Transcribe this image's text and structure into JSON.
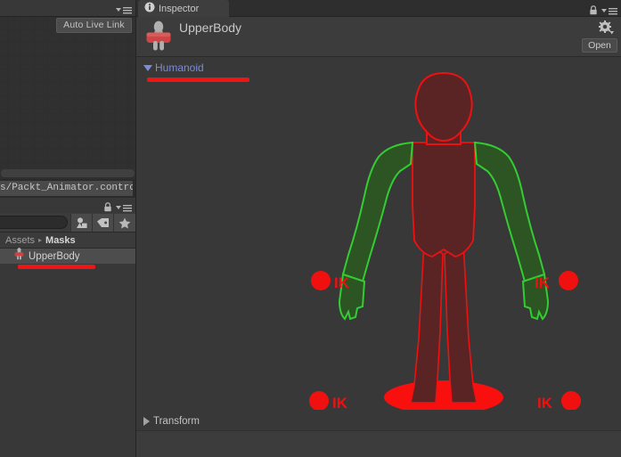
{
  "animator": {
    "menu_icon": "hamburger-menu-icon",
    "auto_live_link_label": "Auto Live Link",
    "controller_path": "s/Packt_Animator.controller"
  },
  "project": {
    "lock_icon": "lock-icon",
    "menu_icon": "hamburger-menu-icon",
    "search_placeholder": "",
    "search_value": "",
    "filters": [
      {
        "name": "filter-by-type-icon",
        "label": ""
      },
      {
        "name": "filter-by-label-icon",
        "label": ""
      },
      {
        "name": "filter-favorite-icon",
        "label": ""
      }
    ],
    "breadcrumb": {
      "root": "Assets",
      "separator": "▸",
      "current": "Masks"
    },
    "assets": [
      {
        "name": "UpperBody",
        "icon": "avatar-mask-icon",
        "selected": true
      }
    ]
  },
  "inspector": {
    "tab_label": "Inspector",
    "tab_icon": "info-icon",
    "lock_icon": "lock-icon",
    "menu_icon": "hamburger-menu-icon",
    "title": "UpperBody",
    "asset_icon": "avatar-mask-icon",
    "gear_icon": "gear-icon",
    "open_label": "Open",
    "sections": {
      "humanoid": {
        "label": "Humanoid",
        "expanded": true,
        "triangle": "▼"
      },
      "transform": {
        "label": "Transform",
        "expanded": false,
        "triangle": "▶"
      }
    },
    "avatar_mask": {
      "ik_labels": [
        "IK",
        "IK",
        "IK",
        "IK"
      ],
      "parts": {
        "head": "inactive",
        "torso": "inactive",
        "left_arm": "active",
        "right_arm": "active",
        "left_hand": "active",
        "right_hand": "active",
        "left_leg": "inactive",
        "right_leg": "inactive",
        "root": "inactive"
      }
    }
  },
  "colors": {
    "active": "#33cc33",
    "inactive_outline": "#ee1111",
    "inactive_fill": "#5a2424",
    "active_fill": "#2d5423",
    "annotation": "#f01414",
    "foldout_blue": "#7b8bd6",
    "panel_bg": "#383838"
  }
}
